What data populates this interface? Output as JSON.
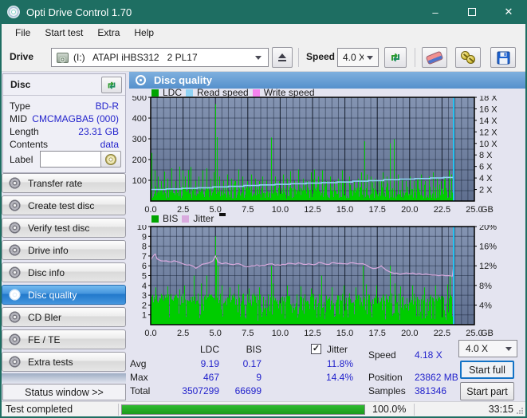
{
  "window": {
    "title": "Opti Drive Control 1.70"
  },
  "titlebar": {
    "minimize_glyph": "–",
    "maximize_glyph": "❒",
    "close_glyph": "✕"
  },
  "menu": {
    "items": [
      "File",
      "Start test",
      "Extra",
      "Help"
    ]
  },
  "toolbar": {
    "drive_label": "Drive",
    "drive_value": "(I:)   ATAPI iHBS312   2 PL17",
    "speed_label": "Speed",
    "speed_value": "4.0 X"
  },
  "sidebar": {
    "disc_panel": {
      "title": "Disc",
      "rows": [
        {
          "label": "Type",
          "value": "BD-R"
        },
        {
          "label": "MID",
          "value": "CMCMAGBA5 (000)"
        },
        {
          "label": "Length",
          "value": "23.31 GB"
        },
        {
          "label": "Contents",
          "value": "data"
        }
      ],
      "label_label": "Label",
      "label_value": ""
    },
    "buttons": [
      {
        "label": "Transfer rate"
      },
      {
        "label": "Create test disc"
      },
      {
        "label": "Verify test disc"
      },
      {
        "label": "Drive info"
      },
      {
        "label": "Disc info"
      },
      {
        "label": "Disc quality",
        "active": true
      },
      {
        "label": "CD Bler"
      },
      {
        "label": "FE / TE"
      },
      {
        "label": "Extra tests"
      }
    ],
    "status_window_label": "Status window >>"
  },
  "main": {
    "header": "Disc quality"
  },
  "stats": {
    "col_ldc": "LDC",
    "col_bis": "BIS",
    "jitter_label": "Jitter",
    "jitter_checked": true,
    "jitter_check_glyph": "✓",
    "row_avg": "Avg",
    "row_max": "Max",
    "row_total": "Total",
    "avg_ldc": "9.19",
    "avg_bis": "0.17",
    "avg_jitter": "11.8%",
    "max_ldc": "467",
    "max_bis": "9",
    "max_jitter": "14.4%",
    "total_ldc": "3507299",
    "total_bis": "66699",
    "speed_label": "Speed",
    "speed_value": "4.18 X",
    "position_label": "Position",
    "position_value": "23862 MB",
    "samples_label": "Samples",
    "samples_value": "381346"
  },
  "controls": {
    "speed_select": "4.0 X",
    "start_full": "Start full",
    "start_part": "Start part"
  },
  "statusbar": {
    "text": "Test completed",
    "progress_value": 100,
    "progress_pct": "100.0%",
    "time": "33:15"
  },
  "chart_data": [
    {
      "type": "bar",
      "title": "LDC errors with read/write speed overlay",
      "legend": [
        {
          "label": "LDC",
          "color": "#00a400"
        },
        {
          "label": "Read speed",
          "color": "#8fd2f4"
        },
        {
          "label": "Write speed",
          "color": "#f582ee"
        }
      ],
      "x_range": [
        0,
        25
      ],
      "x_ticks": [
        "0.0",
        "2.5",
        "5.0",
        "7.5",
        "10.0",
        "12.5",
        "15.0",
        "17.5",
        "20.0",
        "22.5",
        "25.0"
      ],
      "x_unit": "GB",
      "y_left": {
        "range": [
          0,
          500
        ],
        "ticks": [
          500,
          400,
          300,
          200,
          100
        ],
        "grid_step": 50
      },
      "y_right": {
        "range": [
          0,
          18
        ],
        "ticks": [
          "18 X",
          "16 X",
          "14 X",
          "12 X",
          "10 X",
          "8 X",
          "6 X",
          "4 X",
          "2 X"
        ]
      },
      "data_end_x": 23.4,
      "ldc": {
        "baseline_range": [
          12,
          70
        ],
        "spikes": [
          [
            0.05,
            232
          ],
          [
            0.3,
            148
          ],
          [
            0.55,
            118
          ],
          [
            0.8,
            96
          ],
          [
            1.05,
            142
          ],
          [
            1.3,
            108
          ],
          [
            1.6,
            158
          ],
          [
            1.9,
            96
          ],
          [
            2.2,
            166
          ],
          [
            2.45,
            148
          ],
          [
            2.65,
            118
          ],
          [
            2.9,
            150
          ],
          [
            3.1,
            164
          ],
          [
            3.45,
            98
          ],
          [
            3.7,
            118
          ],
          [
            4.0,
            148
          ],
          [
            4.3,
            158
          ],
          [
            4.6,
            108
          ],
          [
            4.85,
            140
          ],
          [
            5.0,
            467
          ],
          [
            5.1,
            308
          ],
          [
            5.3,
            118
          ],
          [
            5.6,
            98
          ],
          [
            5.9,
            128
          ],
          [
            6.2,
            108
          ],
          [
            6.5,
            96
          ],
          [
            6.8,
            152
          ],
          [
            7.1,
            118
          ],
          [
            7.45,
            96
          ],
          [
            7.75,
            128
          ],
          [
            8.05,
            108
          ],
          [
            8.35,
            96
          ],
          [
            8.65,
            118
          ],
          [
            8.95,
            98
          ],
          [
            9.3,
            306
          ],
          [
            9.6,
            118
          ],
          [
            9.9,
            96
          ],
          [
            10.2,
            128
          ],
          [
            10.5,
            108
          ],
          [
            10.8,
            144
          ],
          [
            11.1,
            98
          ],
          [
            11.4,
            152
          ],
          [
            11.75,
            108
          ],
          [
            12.05,
            96
          ],
          [
            12.35,
            138
          ],
          [
            12.65,
            152
          ],
          [
            12.95,
            118
          ],
          [
            13.25,
            148
          ],
          [
            13.55,
            96
          ],
          [
            13.85,
            118
          ],
          [
            14.15,
            96
          ],
          [
            14.45,
            108
          ],
          [
            14.75,
            148
          ],
          [
            15.05,
            96
          ],
          [
            15.35,
            118
          ],
          [
            15.7,
            96
          ],
          [
            16.0,
            108
          ],
          [
            16.25,
            138
          ],
          [
            16.5,
            288
          ],
          [
            16.7,
            128
          ],
          [
            17.0,
            118
          ],
          [
            17.3,
            108
          ],
          [
            17.6,
            96
          ],
          [
            17.9,
            138
          ],
          [
            18.2,
            118
          ],
          [
            18.5,
            278
          ],
          [
            18.8,
            298
          ],
          [
            19.1,
            128
          ],
          [
            19.4,
            108
          ],
          [
            19.7,
            96
          ],
          [
            20.0,
            118
          ],
          [
            20.3,
            96
          ],
          [
            20.6,
            108
          ],
          [
            20.9,
            128
          ],
          [
            21.2,
            96
          ],
          [
            21.5,
            118
          ],
          [
            21.8,
            138
          ],
          [
            22.1,
            108
          ],
          [
            22.4,
            96
          ],
          [
            22.7,
            118
          ],
          [
            23.0,
            148
          ],
          [
            23.2,
            128
          ]
        ]
      },
      "read_speed": {
        "units": "X",
        "steps": [
          [
            0,
            2.0
          ],
          [
            1.2,
            2.1
          ],
          [
            2.4,
            2.2
          ],
          [
            3.6,
            2.3
          ],
          [
            4.8,
            2.45
          ],
          [
            6.0,
            2.55
          ],
          [
            7.2,
            2.7
          ],
          [
            8.4,
            2.8
          ],
          [
            9.6,
            2.9
          ],
          [
            10.8,
            3.0
          ],
          [
            12.0,
            3.1
          ],
          [
            13.2,
            3.2
          ],
          [
            14.4,
            3.3
          ],
          [
            15.6,
            3.45
          ],
          [
            16.8,
            3.55
          ],
          [
            18.0,
            3.7
          ],
          [
            19.2,
            3.8
          ],
          [
            20.4,
            3.9
          ],
          [
            21.6,
            4.0
          ],
          [
            22.6,
            4.1
          ],
          [
            23.4,
            4.18
          ]
        ],
        "color": "#8fd2f4",
        "end_line_color": "#26c3f2"
      }
    },
    {
      "type": "bar",
      "title": "BIS errors with jitter overlay",
      "legend": [
        {
          "label": "BIS",
          "color": "#00a400"
        },
        {
          "label": "Jitter",
          "color": "#d9aade"
        }
      ],
      "x_range": [
        0,
        25
      ],
      "x_ticks": [
        "0.0",
        "2.5",
        "5.0",
        "7.5",
        "10.0",
        "12.5",
        "15.0",
        "17.5",
        "20.0",
        "22.5",
        "25.0"
      ],
      "x_unit": "GB",
      "y_left": {
        "range": [
          0,
          10
        ],
        "ticks": [
          10,
          9,
          8,
          7,
          6,
          5,
          4,
          3,
          2,
          1
        ],
        "grid_step": 1
      },
      "y_right": {
        "range": [
          0,
          20
        ],
        "ticks": [
          "20%",
          "16%",
          "12%",
          "8%",
          "4%"
        ]
      },
      "data_end_x": 23.4,
      "bis": {
        "baseline_range": [
          0.4,
          3.2
        ],
        "spikes": [
          [
            0.4,
            3.8
          ],
          [
            1.3,
            3.9
          ],
          [
            2.2,
            3.6
          ],
          [
            2.6,
            4.0
          ],
          [
            3.3,
            5.0
          ],
          [
            3.9,
            4.2
          ],
          [
            4.3,
            5.0
          ],
          [
            5.0,
            9.0
          ],
          [
            5.07,
            7.0
          ],
          [
            5.15,
            6.0
          ],
          [
            5.5,
            4.0
          ],
          [
            6.1,
            3.8
          ],
          [
            6.8,
            4.1
          ],
          [
            7.6,
            3.7
          ],
          [
            8.4,
            3.8
          ],
          [
            9.3,
            6.0
          ],
          [
            9.42,
            4.2
          ],
          [
            10.5,
            4.0
          ],
          [
            11.6,
            3.9
          ],
          [
            12.4,
            3.7
          ],
          [
            13.2,
            5.0
          ],
          [
            14.0,
            3.8
          ],
          [
            14.9,
            4.0
          ],
          [
            15.8,
            3.8
          ],
          [
            16.4,
            6.0
          ],
          [
            16.62,
            4.1
          ],
          [
            17.4,
            4.0
          ],
          [
            18.5,
            6.0
          ],
          [
            18.82,
            4.2
          ],
          [
            19.3,
            3.9
          ],
          [
            20.2,
            4.0
          ],
          [
            21.1,
            3.8
          ],
          [
            22.0,
            4.0
          ],
          [
            22.9,
            4.1
          ],
          [
            23.1,
            5.0
          ]
        ]
      },
      "jitter": {
        "units": "%",
        "color": "#d9aade",
        "points": [
          [
            0,
            13.2
          ],
          [
            0.2,
            14.0
          ],
          [
            0.35,
            14.4
          ],
          [
            0.5,
            13.4
          ],
          [
            0.8,
            13.0
          ],
          [
            1.2,
            13.0
          ],
          [
            1.6,
            12.8
          ],
          [
            2.0,
            12.9
          ],
          [
            2.3,
            12.6
          ],
          [
            2.6,
            12.3
          ],
          [
            3.0,
            12.2
          ],
          [
            3.3,
            11.9
          ],
          [
            3.5,
            11.5
          ],
          [
            3.8,
            12.0
          ],
          [
            4.2,
            12.4
          ],
          [
            4.5,
            12.6
          ],
          [
            4.8,
            13.0
          ],
          [
            5.0,
            14.0
          ],
          [
            5.2,
            12.8
          ],
          [
            5.5,
            12.4
          ],
          [
            5.8,
            12.6
          ],
          [
            6.2,
            12.3
          ],
          [
            6.6,
            12.4
          ],
          [
            7.0,
            12.2
          ],
          [
            7.4,
            11.8
          ],
          [
            7.8,
            12.0
          ],
          [
            8.2,
            12.2
          ],
          [
            8.6,
            12.1
          ],
          [
            9.0,
            12.3
          ],
          [
            9.4,
            12.4
          ],
          [
            9.8,
            12.2
          ],
          [
            10.2,
            12.3
          ],
          [
            10.6,
            12.5
          ],
          [
            11.0,
            12.4
          ],
          [
            11.4,
            12.6
          ],
          [
            11.8,
            12.3
          ],
          [
            12.2,
            12.4
          ],
          [
            12.6,
            12.2
          ],
          [
            13.0,
            12.7
          ],
          [
            13.4,
            12.4
          ],
          [
            13.8,
            12.3
          ],
          [
            14.2,
            12.6
          ],
          [
            14.6,
            12.5
          ],
          [
            15.0,
            12.4
          ],
          [
            15.4,
            12.6
          ],
          [
            15.8,
            12.5
          ],
          [
            16.2,
            12.4
          ],
          [
            16.6,
            12.2
          ],
          [
            17.0,
            11.6
          ],
          [
            17.4,
            11.5
          ],
          [
            17.8,
            12.0
          ],
          [
            18.2,
            11.1
          ],
          [
            18.6,
            10.6
          ],
          [
            19.0,
            10.5
          ],
          [
            19.5,
            10.4
          ],
          [
            20.0,
            10.4
          ],
          [
            20.5,
            10.3
          ],
          [
            21.0,
            10.2
          ],
          [
            21.5,
            10.2
          ],
          [
            22.0,
            10.1
          ],
          [
            22.5,
            10.1
          ],
          [
            23.0,
            10.0
          ],
          [
            23.3,
            9.9
          ],
          [
            23.4,
            12.0
          ]
        ],
        "end_line_color": "#26c3f2"
      }
    }
  ]
}
